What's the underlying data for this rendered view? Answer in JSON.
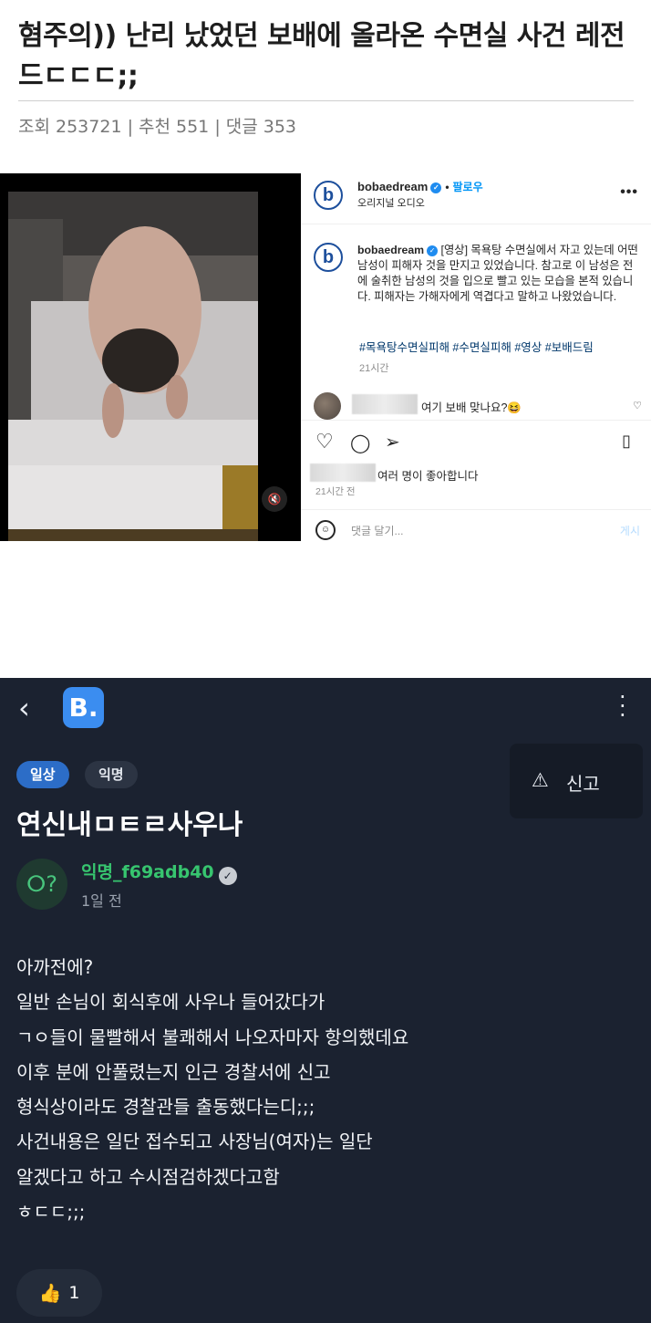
{
  "article": {
    "title": "혐주의)) 난리 났었던 보배에 올라온 수면실 사건 레전드ㄷㄷㄷ;;",
    "meta": "조회 253721 | 추천 551 | 댓글 353"
  },
  "instagram": {
    "account": "bobaedream",
    "follow_label": "팔로우",
    "audio_label": "오리지널 오디오",
    "caption_user": "bobaedream",
    "caption_text": "[영상] 목욕탕 수면실에서 자고 있는데 어떤 남성이 피해자 것을 만지고 있었습니다. 참고로 이 남성은 전에 술취한 남성의 것을 입으로 빨고 있는 모습을 본적 있습니다. 피해자는 가해자에게 역겹다고 말하고 나왔었습니다.",
    "hashtags": "#목욕탕수면실피해 #수면실피해 #영상 #보배드림",
    "caption_time": "21시간",
    "comment_text": "여기 보배 맞나요?😆",
    "likes_text": "여러 명이 좋아합니다",
    "post_time": "21시간 전",
    "comment_placeholder": "댓글 달기...",
    "post_button": "게시"
  },
  "app": {
    "report_label": "신고",
    "tags": [
      "일상",
      "익명"
    ],
    "title": "연신내ㅁㅌㄹ사우나",
    "author": "익명_f69adb40",
    "posted": "1일 전",
    "body_lines": [
      "아까전에?",
      "일반 손님이 회식후에 사우나 들어갔다가",
      "ㄱㅇ들이 물빨해서 불쾌해서 나오자마자 항의했데요",
      "이후 분에 안풀렸는지 인근 경찰서에 신고",
      "형식상이라도 경찰관들 출동했다는디;;;",
      "사건내용은 일단 접수되고 사장님(여자)는 일단",
      "알겠다고 하고 수시점검하겠다고함",
      "ㅎㄷㄷ;;;"
    ],
    "like_count": "1"
  },
  "icons": {
    "back": "chevron-left-icon",
    "brand": "B.",
    "more": "kebab-icon",
    "warning": "warning-icon",
    "thumb": "thumbs-up-icon"
  },
  "colors": {
    "app_bg": "#1b2230",
    "accent_blue": "#2c6dc7",
    "author_green": "#37c56f",
    "ig_link": "#0095f6"
  }
}
